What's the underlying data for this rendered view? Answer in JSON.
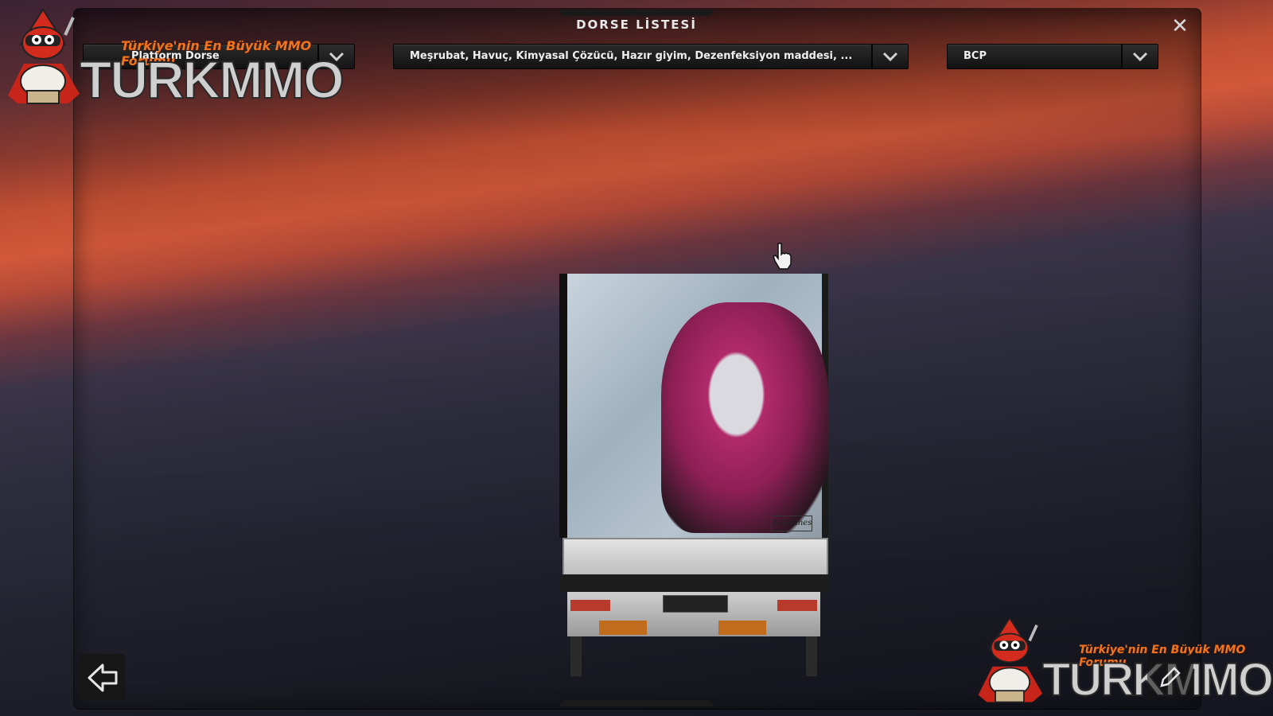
{
  "window": {
    "title": "DORSE LİSTESİ"
  },
  "dropdowns": {
    "trailer_type": {
      "value": "Platform Dorse"
    },
    "cargo": {
      "value": "Meşrubat, Havuç, Kimyasal Çözücü, Hazır giyim, Dezenfeksiyon maddesi, ..."
    },
    "company": {
      "value": "BCP"
    }
  },
  "logo": {
    "tagline": "Türkiye'nin En Büyük MMO Forumu",
    "name": "TURKMMO"
  },
  "trailer_art": {
    "signature": "Autolanes"
  },
  "icons": {
    "close": "close-icon",
    "dropdown": "chevron-down-icon",
    "back": "back-arrow-icon",
    "next": "edit-icon",
    "cursor": "hand-cursor-icon"
  }
}
